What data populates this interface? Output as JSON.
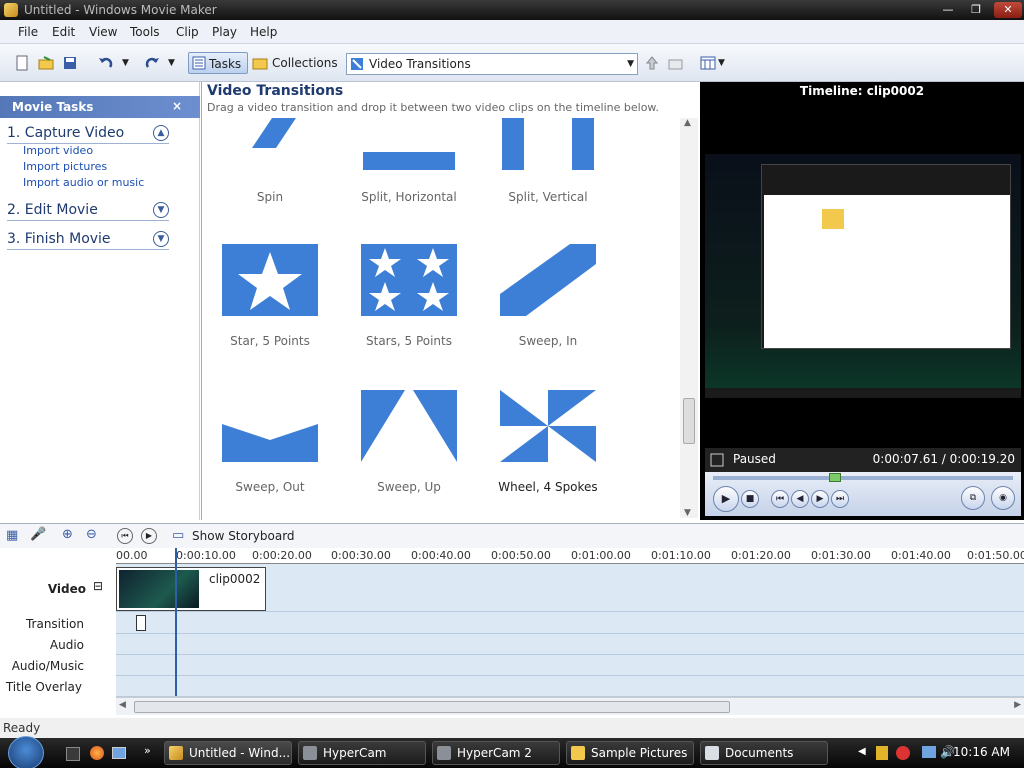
{
  "window": {
    "title": "Untitled - Windows Movie Maker"
  },
  "menu": [
    "File",
    "Edit",
    "View",
    "Tools",
    "Clip",
    "Play",
    "Help"
  ],
  "toolbar": {
    "tasks_label": "Tasks",
    "collections_label": "Collections",
    "collection_select": "Video Transitions"
  },
  "taskpane": {
    "header": "Movie Tasks",
    "close": "×",
    "sections": [
      {
        "label": "1. Capture Video",
        "links": [
          "Import video",
          "Import pictures",
          "Import audio or music"
        ]
      },
      {
        "label": "2. Edit Movie"
      },
      {
        "label": "3. Finish Movie"
      }
    ]
  },
  "content": {
    "title": "Video Transitions",
    "subtitle": "Drag a video transition and drop it between two video clips on the timeline below.",
    "tiles": [
      "Spin",
      "Split, Horizontal",
      "Split, Vertical",
      "Star, 5 Points",
      "Stars, 5 Points",
      "Sweep, In",
      "Sweep, Out",
      "Sweep, Up",
      "Wheel, 4 Spokes"
    ]
  },
  "preview": {
    "title": "Timeline: clip0002",
    "status": "Paused",
    "time": "0:00:07.61 / 0:00:19.20"
  },
  "timeline": {
    "show_storyboard": "Show Storyboard",
    "ticks": [
      "00.00",
      "0:00:10.00",
      "0:00:20.00",
      "0:00:30.00",
      "0:00:40.00",
      "0:00:50.00",
      "0:01:00.00",
      "0:01:10.00",
      "0:01:20.00",
      "0:01:30.00",
      "0:01:40.00",
      "0:01:50.00"
    ],
    "tracks": {
      "video": "Video",
      "transition": "Transition",
      "audio": "Audio",
      "audio_music": "Audio/Music",
      "title_overlay": "Title Overlay"
    },
    "clip_name": "clip0002",
    "collapse": "⊟"
  },
  "status": "Ready",
  "taskbar": {
    "tasks": [
      "Untitled - Wind...",
      "HyperCam",
      "HyperCam 2",
      "Sample Pictures",
      "Documents"
    ],
    "clock": "10:16 AM"
  },
  "colors": {
    "accent": "#3d7fd6",
    "header": "#5477b8",
    "track": "#dce8f4"
  }
}
